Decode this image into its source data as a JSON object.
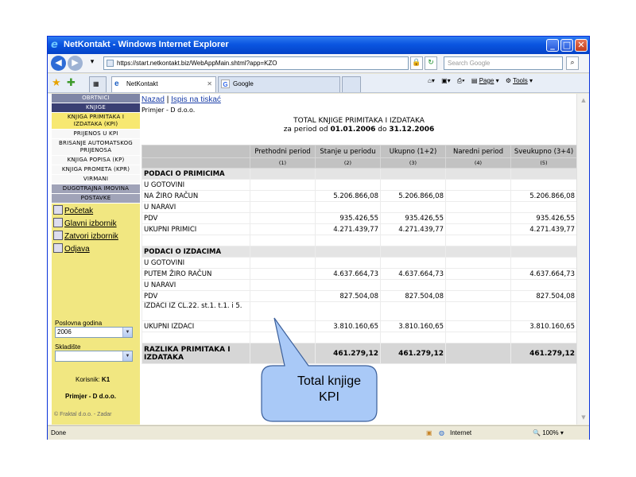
{
  "window": {
    "title": "NetKontakt - Windows Internet Explorer",
    "address": "https://start.netkontakt.biz/WebAppMain.shtml?app=KZO",
    "search_placeholder": "Search Google",
    "tabs": [
      "NetKontakt",
      "Google"
    ],
    "commands": [
      "Page",
      "Tools"
    ],
    "status_left": "Done",
    "status_zone": "Internet",
    "zoom": "100%"
  },
  "sidebar": {
    "header": "OBRTNICI",
    "active_section": "KNJIGE",
    "menu": [
      {
        "label": "KNJIGA PRIMITAKA I IZDATAKA (KPI)",
        "style": "hl"
      },
      {
        "label": "PRIJENOS U KPI",
        "style": "light"
      },
      {
        "label": "BRISANJE AUTOMATSKOG PRIJENOSA",
        "style": "light"
      },
      {
        "label": "KNJIGA POPISA (KP)",
        "style": "light"
      },
      {
        "label": "KNJIGA PROMETA (KPR)",
        "style": "light"
      },
      {
        "label": "VIRMANI",
        "style": "light"
      },
      {
        "label": "DUGOTRAJNA IMOVINA",
        "style": "mid"
      },
      {
        "label": "POSTAVKE",
        "style": "mid"
      }
    ],
    "links": [
      "Početak",
      "Glavni izbornik",
      "Zatvori izbornik",
      "Odjava"
    ],
    "year_label": "Poslovna godina",
    "year_value": "2006",
    "warehouse_label": "Skladište",
    "warehouse_value": "",
    "user_label": "Korisnik:",
    "user_value": "K1",
    "company": "Primjer - D d.o.o.",
    "footer": "© Fraktal d.o.o. - Zadar"
  },
  "main": {
    "link_back": "Nazad",
    "link_separator": "|",
    "link_print": "Ispis na tiskać",
    "company": "Primjer - D d.o.o.",
    "title": "TOTAL KNJIGE PRIMITAKA I IZDATAKA",
    "period_prefix": "za period od",
    "period_from": "01.01.2006",
    "period_mid": "do",
    "period_to": "31.12.2006",
    "columns": [
      "Prethodni period",
      "Stanje u periodu",
      "Ukupno (1+2)",
      "Naredni period",
      "Sveukupno (3+4)"
    ],
    "column_numbers": [
      "(1)",
      "(2)",
      "(3)",
      "(4)",
      "(5)"
    ],
    "rows": [
      {
        "type": "sec",
        "label": "PODACI O PRIMICIMA",
        "v": [
          "",
          "",
          "",
          "",
          ""
        ]
      },
      {
        "type": "row",
        "label": "U GOTOVINI",
        "v": [
          "",
          "",
          "",
          "",
          ""
        ]
      },
      {
        "type": "row",
        "label": "NA ŽIRO RAČUN",
        "v": [
          "",
          "5.206.866,08",
          "5.206.866,08",
          "",
          "5.206.866,08"
        ]
      },
      {
        "type": "row",
        "label": "U NARAVI",
        "v": [
          "",
          "",
          "",
          "",
          ""
        ]
      },
      {
        "type": "row",
        "label": "PDV",
        "v": [
          "",
          "935.426,55",
          "935.426,55",
          "",
          "935.426,55"
        ]
      },
      {
        "type": "row",
        "label": "UKUPNI PRIMICI",
        "v": [
          "",
          "4.271.439,77",
          "4.271.439,77",
          "",
          "4.271.439,77"
        ]
      },
      {
        "type": "blank",
        "label": "",
        "v": [
          "",
          "",
          "",
          "",
          ""
        ]
      },
      {
        "type": "sec",
        "label": "PODACI O IZDACIMA",
        "v": [
          "",
          "",
          "",
          "",
          ""
        ]
      },
      {
        "type": "row",
        "label": "U GOTOVINI",
        "v": [
          "",
          "",
          "",
          "",
          ""
        ]
      },
      {
        "type": "row",
        "label": "PUTEM ŽIRO RAČUN",
        "v": [
          "",
          "4.637.664,73",
          "4.637.664,73",
          "",
          "4.637.664,73"
        ]
      },
      {
        "type": "row",
        "label": "U NARAVI",
        "v": [
          "",
          "",
          "",
          "",
          ""
        ]
      },
      {
        "type": "row",
        "label": "PDV",
        "v": [
          "",
          "827.504,08",
          "827.504,08",
          "",
          "827.504,08"
        ]
      },
      {
        "type": "tall",
        "label": "IZDACI IZ ČL.22. st.1. t.1. i 5.",
        "v": [
          "",
          "",
          "",
          "",
          ""
        ]
      },
      {
        "type": "row",
        "label": "UKUPNI IZDACI",
        "v": [
          "",
          "3.810.160,65",
          "3.810.160,65",
          "",
          "3.810.160,65"
        ]
      },
      {
        "type": "blank",
        "label": "",
        "v": [
          "",
          "",
          "",
          "",
          ""
        ]
      },
      {
        "type": "total",
        "label": "RAZLIKA PRIMITAKA I IZDATAKA",
        "v": [
          "",
          "461.279,12",
          "461.279,12",
          "",
          "461.279,12"
        ]
      }
    ]
  },
  "callout": {
    "line1": "Total knjige",
    "line2": "KPI",
    "fill": "#a9c9f7",
    "stroke": "#3b5f9a"
  }
}
